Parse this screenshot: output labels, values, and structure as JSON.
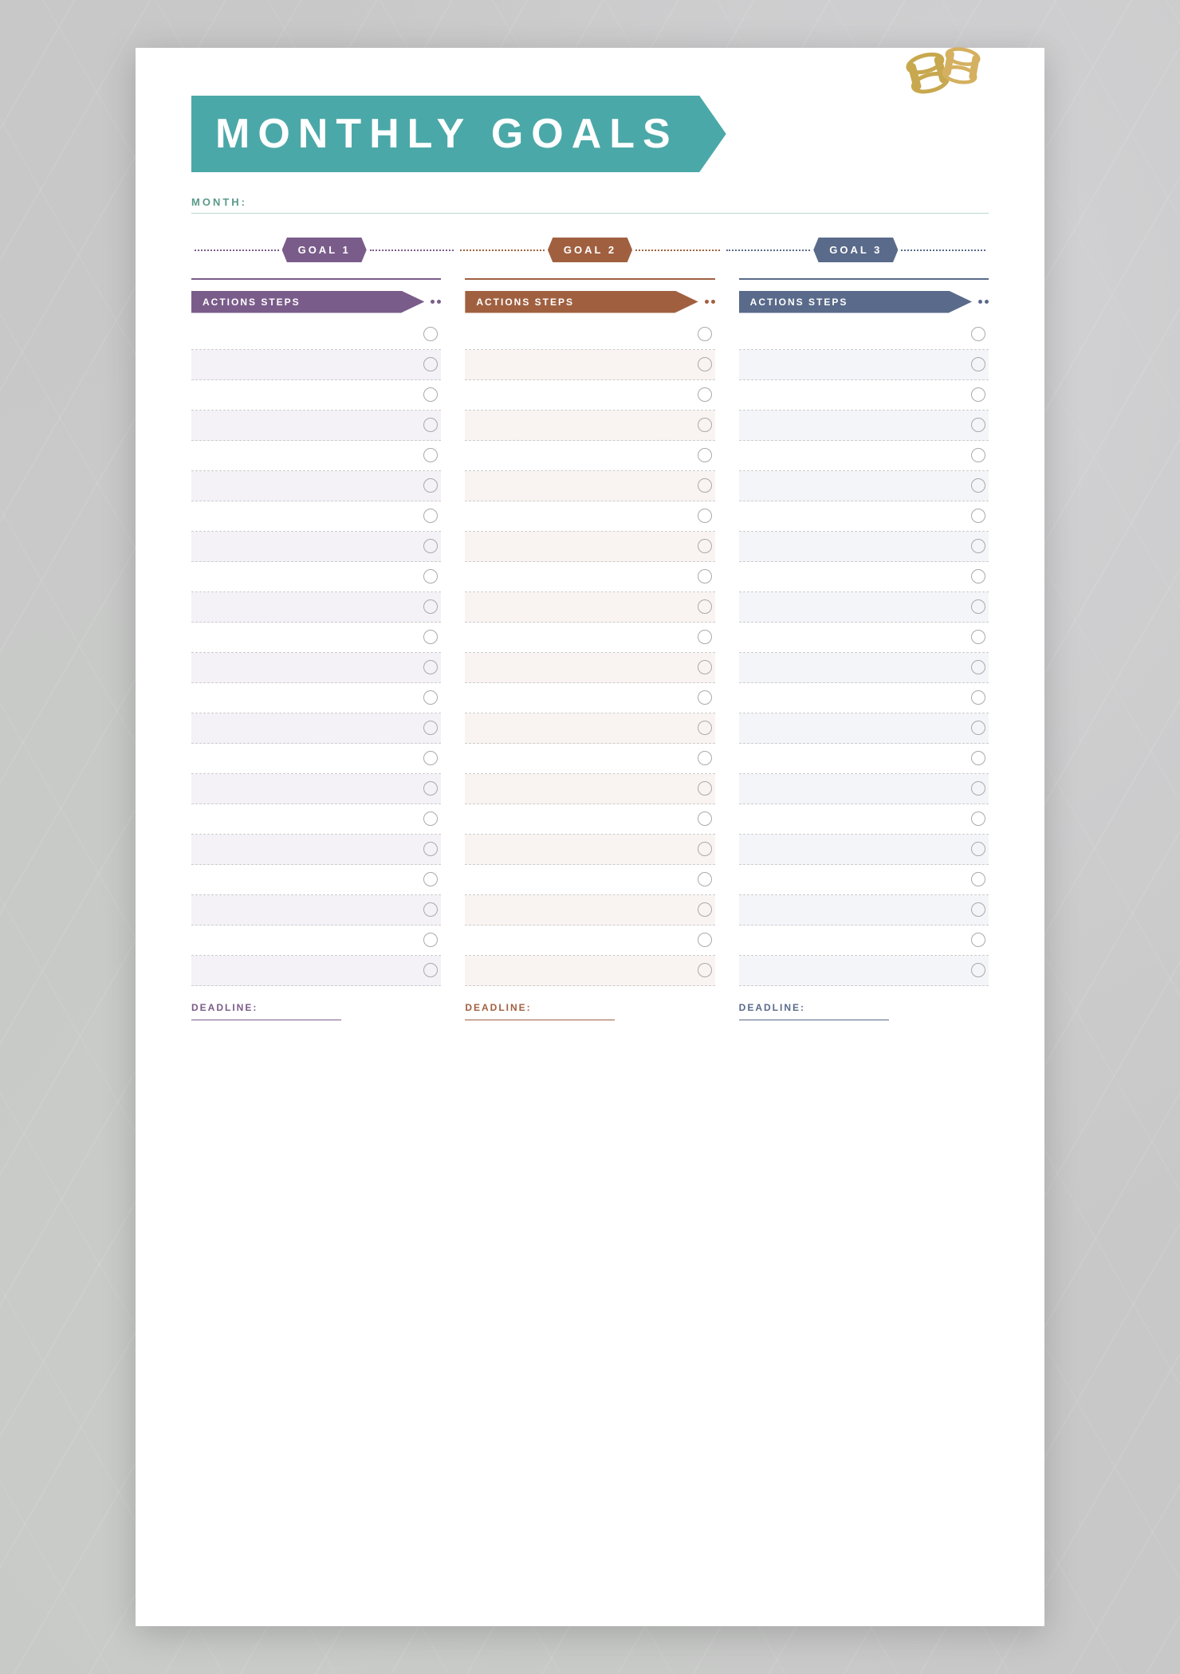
{
  "page": {
    "title": "MONTHLY GOALS",
    "month_label": "MONTH:",
    "goals": [
      {
        "id": "goal1",
        "label": "GOAL 1",
        "color_class": "goal1"
      },
      {
        "id": "goal2",
        "label": "GOAL 2",
        "color_class": "goal2"
      },
      {
        "id": "goal3",
        "label": "GOAL 3",
        "color_class": "goal3"
      }
    ],
    "columns": [
      {
        "id": "col1",
        "actions_label": "ACTIONS STEPS",
        "badge_class": "col1-badge",
        "deadline_label": "DEADLINE:",
        "num_rows": 22
      },
      {
        "id": "col2",
        "actions_label": "ACTIONS STEPS",
        "badge_class": "col2-badge",
        "deadline_label": "DEADLINE:",
        "num_rows": 22
      },
      {
        "id": "col3",
        "actions_label": "ACTIONS STEPS",
        "badge_class": "col3-badge",
        "deadline_label": "DEADLINE:",
        "num_rows": 22
      }
    ]
  }
}
